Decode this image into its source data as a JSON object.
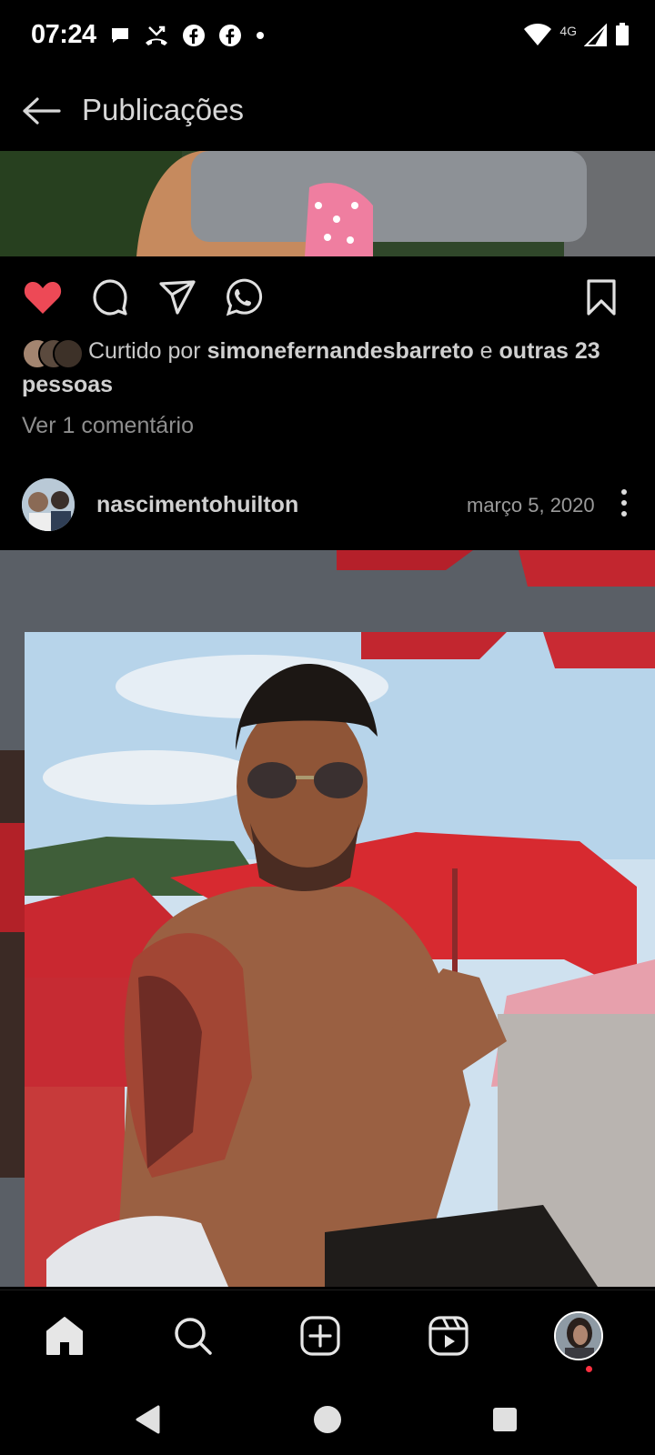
{
  "status_bar": {
    "time": "07:24",
    "network": "4G",
    "notification_icons": [
      "chat-bubble-icon",
      "missed-call-icon",
      "facebook-icon",
      "facebook-icon",
      "dot-icon"
    ],
    "right_icons": [
      "wifi-icon",
      "signal-icon",
      "battery-icon"
    ]
  },
  "header": {
    "title": "Publicações",
    "back_icon": "arrow-left-icon"
  },
  "post1": {
    "liked": true,
    "action_icons": [
      "heart-icon",
      "comment-icon",
      "share-icon",
      "whatsapp-icon",
      "bookmark-icon"
    ],
    "likes": {
      "prefix": "Curtido por",
      "user": "simonefernandesbarreto",
      "connector": "e",
      "others": "outras 23 pessoas"
    },
    "comments_link": "Ver 1 comentário"
  },
  "post2": {
    "username": "nascimentohuilton",
    "date": "março 5, 2020"
  },
  "bottom_nav": {
    "items": [
      "home-icon",
      "search-icon",
      "add-icon",
      "reels-icon",
      "profile-avatar"
    ],
    "notification_color": "#ff3040"
  },
  "system_nav": [
    "back-triangle-icon",
    "home-circle-icon",
    "recents-square-icon"
  ],
  "colors": {
    "background": "#000000",
    "like_red": "#ed4956",
    "text": "#d0d0d0",
    "muted": "#8e8e8e"
  }
}
